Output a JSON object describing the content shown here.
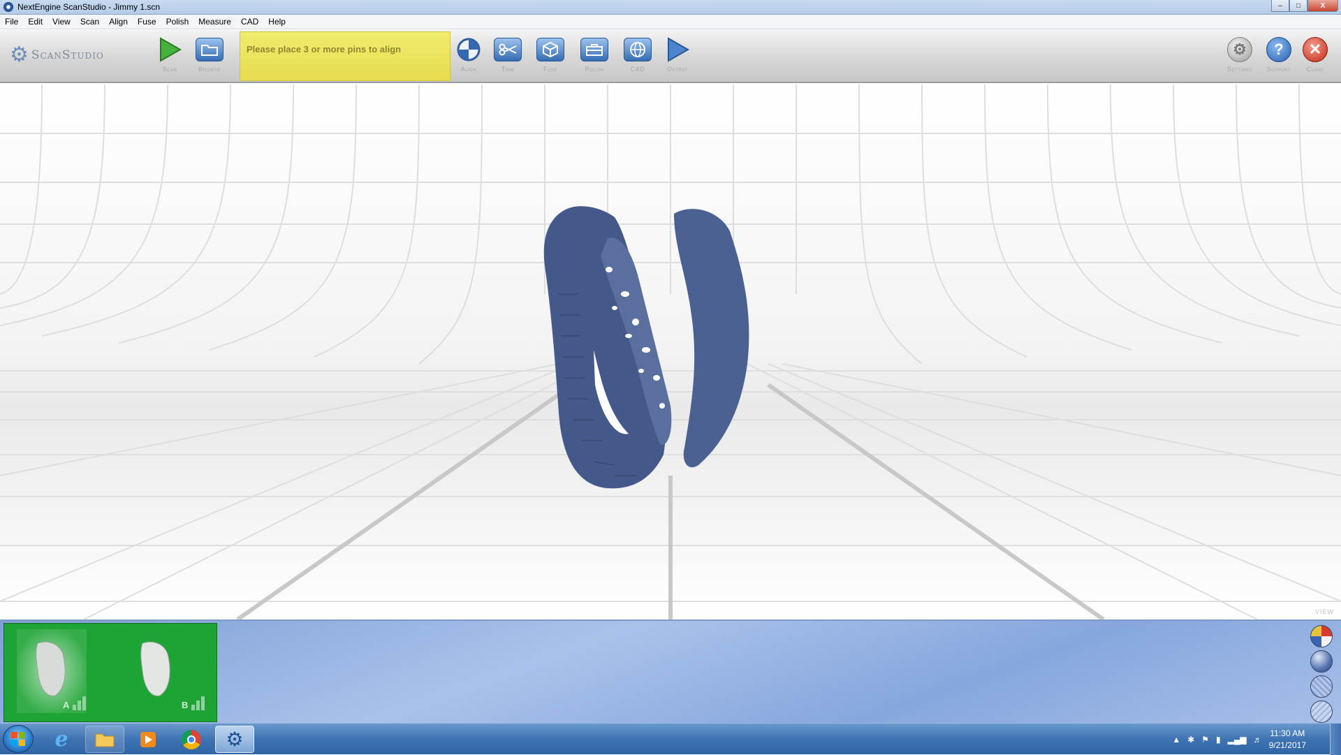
{
  "window": {
    "title": "NextEngine ScanStudio - Jimmy 1.scn",
    "controls": [
      "–",
      "□",
      "X"
    ]
  },
  "menu": [
    "File",
    "Edit",
    "View",
    "Scan",
    "Align",
    "Fuse",
    "Polish",
    "Measure",
    "CAD",
    "Help"
  ],
  "toolbar": {
    "logo_text": "ScanStudio",
    "scan_label": "Scan",
    "browse_label": "Browse",
    "message": "Please place 3 or more pins to align",
    "align_label": "Align",
    "trim_label": "Trim",
    "fuse_label": "Fuse",
    "polish_label": "Polish",
    "cad_label": "CAD",
    "output_label": "Output",
    "settings_label": "Settings",
    "support_label": "Support",
    "close_label": "Close"
  },
  "viewport": {
    "view_label": "VIEW"
  },
  "scans": [
    {
      "label": "A",
      "selected": true
    },
    {
      "label": "B",
      "selected": false
    }
  ],
  "taskbar": {
    "apps": [
      "windows-explorer",
      "internet-explorer",
      "file-explorer",
      "media-player",
      "chrome",
      "scanstudio"
    ],
    "clock_time": "11:30 AM",
    "clock_date": "9/21/2017"
  },
  "colors": {
    "scan_mesh": "#44598a",
    "message_bg": "#ece564",
    "thumb_strip": "#1ea435",
    "accent_blue": "#356cb3"
  }
}
